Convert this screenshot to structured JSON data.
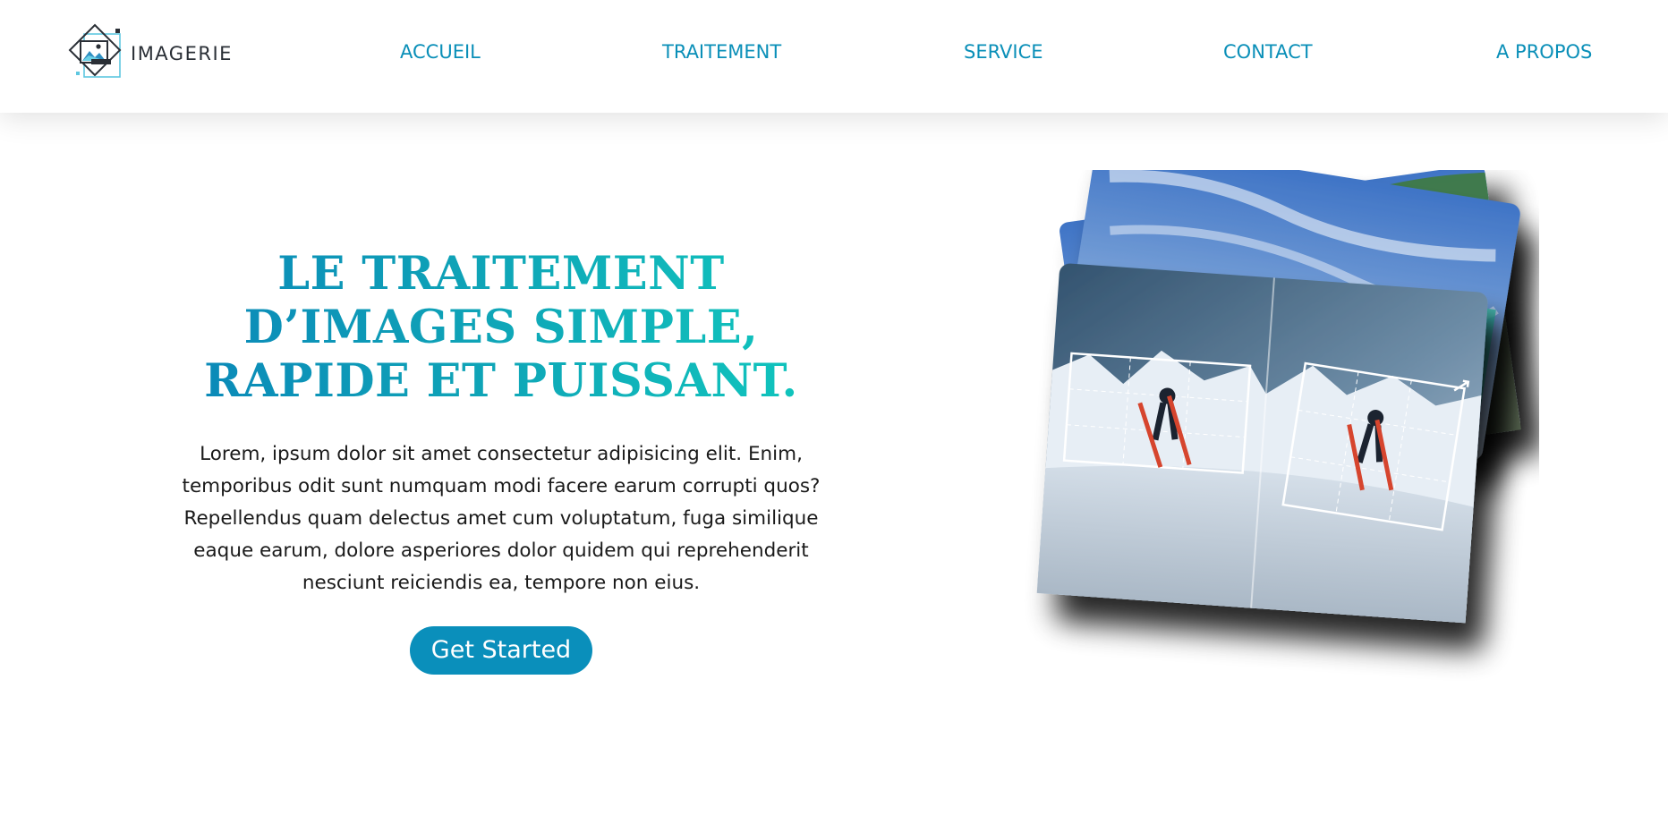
{
  "brand": {
    "name": "IMAGERIE"
  },
  "nav": {
    "items": [
      {
        "label": "ACCUEIL"
      },
      {
        "label": "TRAITEMENT"
      },
      {
        "label": "SERVICE"
      },
      {
        "label": "CONTACT"
      },
      {
        "label": "A PROPOS"
      }
    ]
  },
  "hero": {
    "title_line1": "LE TRAITEMENT",
    "title_line2": "D’IMAGES SIMPLE,",
    "title_line3": "RAPIDE ET PUISSANT.",
    "body": "Lorem, ipsum dolor sit amet consectetur adipisicing elit. Enim, temporibus odit sunt numquam modi facere earum corrupti quos? Repellendus quam delectus amet cum voluptatum, fuga similique eaque earum, dolore asperiores dolor quidem qui reprehenderit nesciunt reiciendis ea, tempore non eius.",
    "cta_label": "Get Started"
  },
  "colors": {
    "accent": "#0a8fbb",
    "nav_text": "#0a8fb8",
    "gradient_start": "#0a86b8",
    "gradient_end": "#10c8bd"
  },
  "icons": {
    "logo": "image-frame-logo-icon",
    "crop_handle": "crop-resize-icon"
  }
}
